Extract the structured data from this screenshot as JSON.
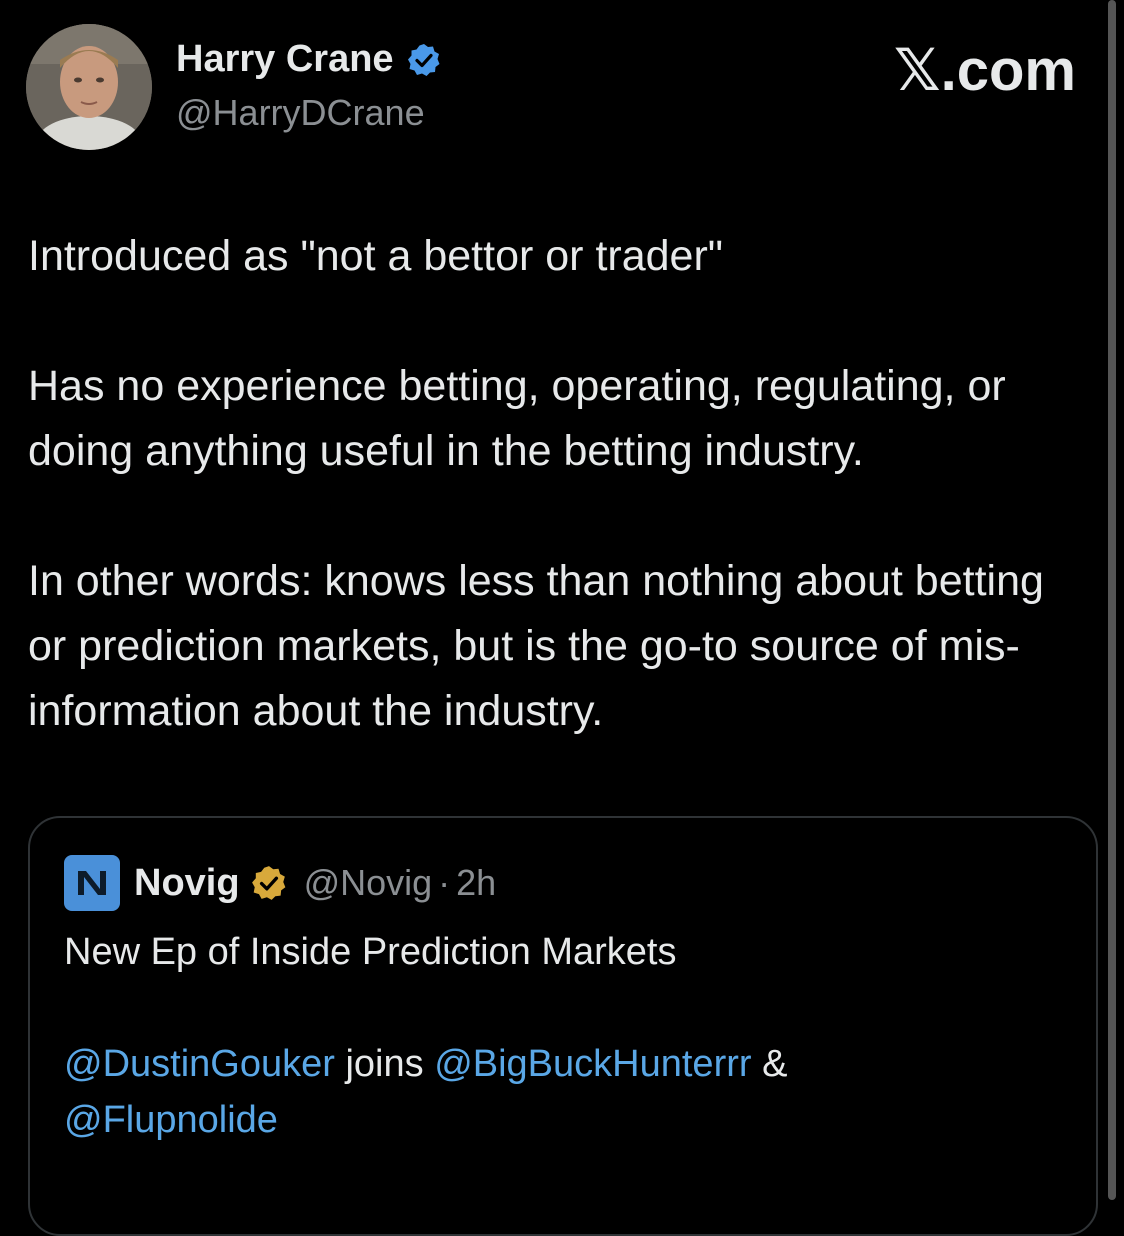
{
  "author": {
    "name": "Harry Crane",
    "handle": "@HarryDCrane",
    "verified": true
  },
  "brand": {
    "logo_text": "𝕏.com"
  },
  "tweet": {
    "paragraphs": [
      "Introduced as \"not a bettor or trader\"",
      "Has no experience betting, operating, regulating, or doing anything useful in the betting industry.",
      "In other words: knows less than nothing about betting or prediction markets, but is the go-to source of mis-information about the industry."
    ]
  },
  "quote": {
    "name": "Novig",
    "handle": "@Novig",
    "separator": "·",
    "time": "2h",
    "line1": "New Ep of Inside Prediction Markets",
    "mention1": "@DustinGouker",
    "joins": " joins ",
    "mention2": "@BigBuckHunterrr",
    "amp": " &",
    "mention3": "@Flupnolide"
  },
  "colors": {
    "background": "#000000",
    "text": "#e7e9ea",
    "secondary": "#8b8f93",
    "link": "#5aa7e6",
    "verified_blue": "#4a99e9",
    "verified_gold": "#d8a93b"
  },
  "icons": {
    "verified": "verified-badge-icon",
    "gold_verified": "gold-verified-badge-icon",
    "novig": "novig-logo-icon"
  }
}
